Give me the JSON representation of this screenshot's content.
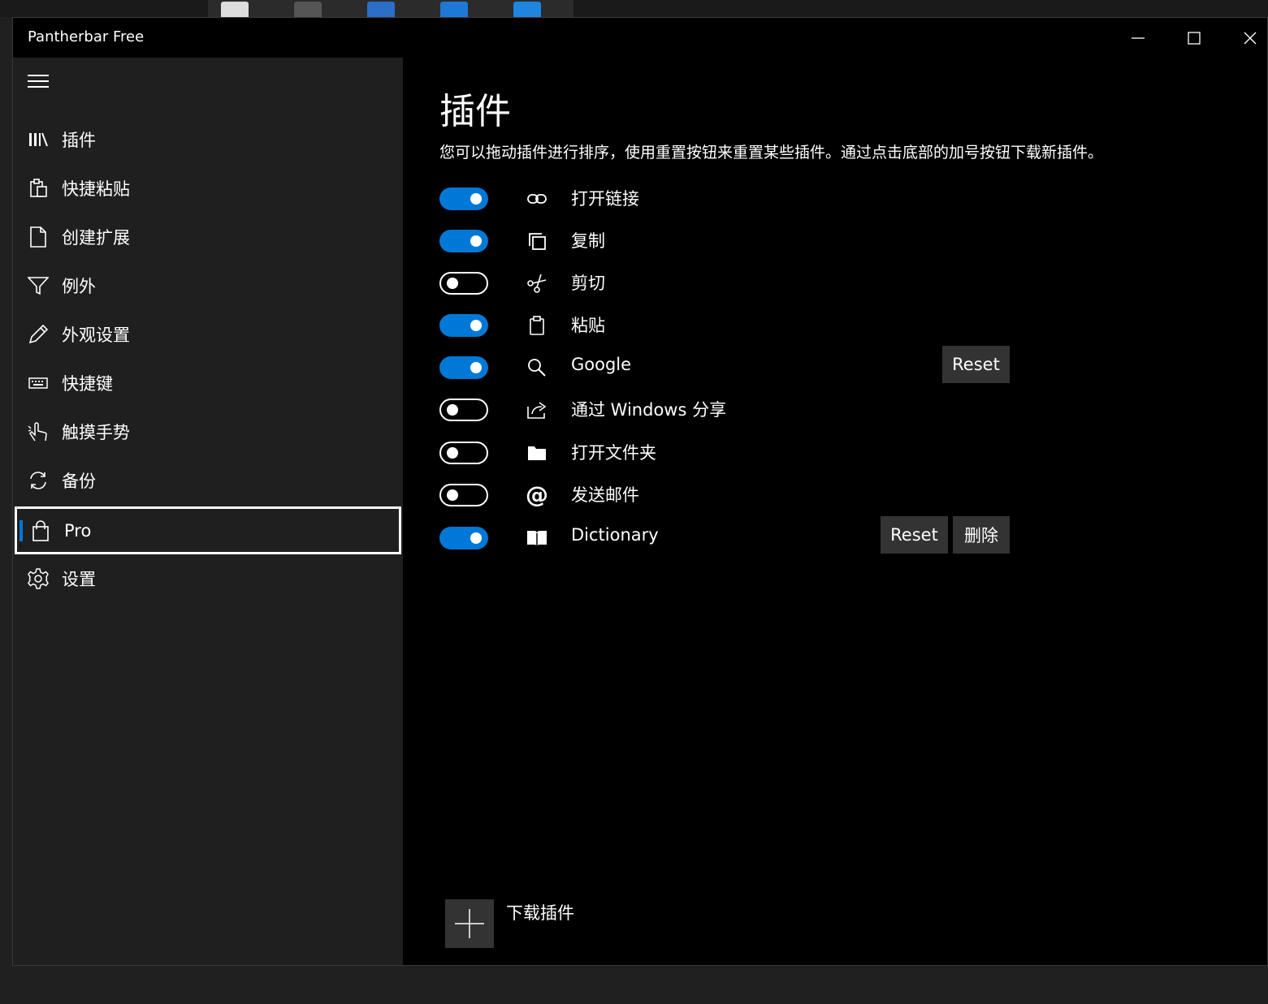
{
  "window": {
    "title": "Pantherbar Free"
  },
  "sidebar": {
    "items": [
      {
        "label": "插件",
        "icon": "library-icon"
      },
      {
        "label": "快捷粘贴",
        "icon": "clipboard-paste-icon"
      },
      {
        "label": "创建扩展",
        "icon": "document-icon"
      },
      {
        "label": "例外",
        "icon": "filter-icon"
      },
      {
        "label": "外观设置",
        "icon": "pencil-icon"
      },
      {
        "label": "快捷键",
        "icon": "keyboard-icon"
      },
      {
        "label": "触摸手势",
        "icon": "touch-hand-icon"
      },
      {
        "label": "备份",
        "icon": "sync-icon"
      },
      {
        "label": "Pro",
        "icon": "shopping-bag-icon",
        "selected": true
      },
      {
        "label": "设置",
        "icon": "gear-icon"
      }
    ]
  },
  "main": {
    "title": "插件",
    "description": "您可以拖动插件进行排序，使用重置按钮来重置某些插件。通过点击底部的加号按钮下载新插件。",
    "plugins": [
      {
        "label": "打开链接",
        "icon": "link-icon",
        "enabled": true
      },
      {
        "label": "复制",
        "icon": "copy-icon",
        "enabled": true
      },
      {
        "label": "剪切",
        "icon": "scissors-icon",
        "enabled": false
      },
      {
        "label": "粘贴",
        "icon": "paste-icon",
        "enabled": true
      },
      {
        "label": "Google",
        "icon": "search-icon",
        "enabled": true,
        "reset_label": "Reset"
      },
      {
        "label": "通过 Windows 分享",
        "icon": "share-icon",
        "enabled": false
      },
      {
        "label": "打开文件夹",
        "icon": "folder-icon",
        "enabled": false
      },
      {
        "label": "发送邮件",
        "icon": "at-icon",
        "enabled": false
      },
      {
        "label": "Dictionary",
        "icon": "book-icon",
        "enabled": true,
        "reset_label": "Reset",
        "delete_label": "删除"
      }
    ],
    "add_label": "下载插件"
  },
  "colors": {
    "accent": "#0078d7",
    "sidebar_bg": "#1f1f1f",
    "content_bg": "#000000",
    "button_bg": "#333333"
  }
}
